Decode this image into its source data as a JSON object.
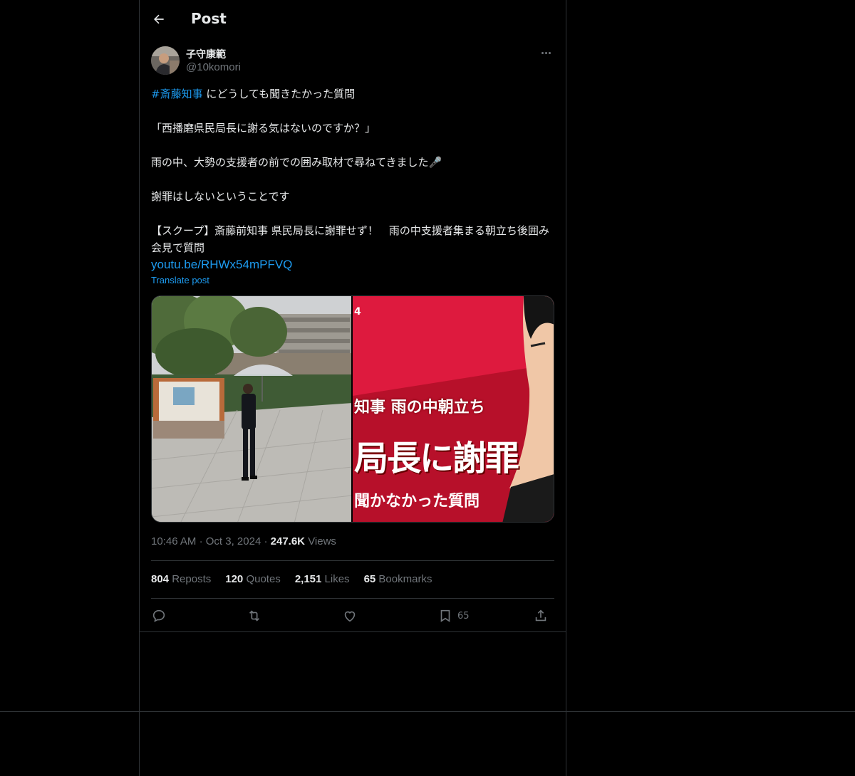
{
  "header": {
    "title": "Post"
  },
  "author": {
    "name": "子守康範",
    "handle": "@10komori"
  },
  "post": {
    "hashtag": "#斎藤知事",
    "line1_rest": " にどうしても聞きたかった質問",
    "line2": "「西播磨県民局長に謝る気はないのですか？」",
    "line3": "雨の中、大勢の支援者の前での囲み取材で尋ねてきました🎤",
    "line4": "謝罪はしないということです",
    "line5": "【スクープ】斎藤前知事 県民局長に謝罪せず！　雨の中支援者集まる朝立ち後囲み会見で質問",
    "link": "youtu.be/RHWx54mPFVQ",
    "translate": "Translate post"
  },
  "media": {
    "thumb_number": "4",
    "caption_top": "知事 雨の中朝立ち",
    "caption_main": "局長に謝罪",
    "caption_bottom": "聞かなかった質問"
  },
  "meta": {
    "time": "10:46 AM",
    "date": "Oct 3, 2024",
    "views_count": "247.6K",
    "views_label": "Views"
  },
  "stats": {
    "reposts_count": "804",
    "reposts_label": "Reposts",
    "quotes_count": "120",
    "quotes_label": "Quotes",
    "likes_count": "2,151",
    "likes_label": "Likes",
    "bookmarks_count": "65",
    "bookmarks_label": "Bookmarks"
  },
  "actions": {
    "bookmark_count": "65"
  },
  "colors": {
    "background": "#000000",
    "accent": "#1d9bf0",
    "muted": "#71767b",
    "border": "#2f3336"
  },
  "icons": [
    "back-arrow-icon",
    "more-icon",
    "reply-icon",
    "repost-icon",
    "like-icon",
    "bookmark-icon",
    "share-icon"
  ]
}
